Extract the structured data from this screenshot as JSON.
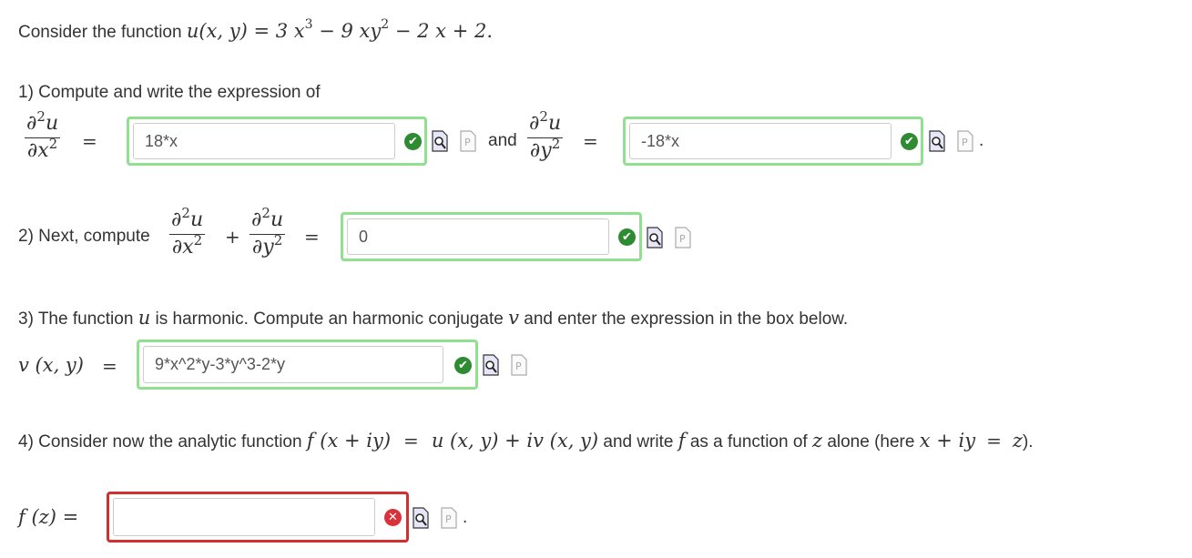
{
  "intro": {
    "text": "Consider the function ",
    "func": "u(x, y) = 3 x",
    "exp1": "3",
    "mid": " − 9 xy",
    "exp2": "2",
    "tail": " − 2 x + 2",
    "period": "."
  },
  "q1": {
    "text": "1) Compute and write the expression of",
    "frac_xx": {
      "num": "∂",
      "num_exp": "2",
      "num_var": "u",
      "den": "∂x",
      "den_exp": "2"
    },
    "frac_yy": {
      "num": "∂",
      "num_exp": "2",
      "num_var": "u",
      "den": "∂y",
      "den_exp": "2"
    },
    "eq": "=",
    "and": "and",
    "answer_xx": "18*x",
    "answer_yy": "-18*x",
    "period": "."
  },
  "q2": {
    "text": "2) Next, compute",
    "plus": "+",
    "eq": "=",
    "answer": "0"
  },
  "q3": {
    "text_a": "3) The function ",
    "var_u": "u",
    "text_b": " is harmonic. Compute an harmonic conjugate ",
    "var_v": "v",
    "text_c": " and enter the expression in the box below.",
    "lhs": "v (x, y)",
    "eq": "=",
    "answer": "9*x^2*y-3*y^3-2*y"
  },
  "q4": {
    "text_a": "4) Consider now the analytic function ",
    "expr_f": "f (x + iy)",
    "eq": "=",
    "expr_rhs": "u (x, y) + iv (x, y)",
    "text_b": " and write ",
    "var_f": "f",
    "text_c": " as a function of ",
    "var_z": "z",
    "text_d": " alone (here ",
    "expr_xiy": "x + iy",
    "eq2": "=",
    "var_z2": "z",
    "text_e": ").",
    "lhs": "f (z) =",
    "answer": "",
    "period": "."
  },
  "status": {
    "correct": "✔",
    "incorrect": "✕"
  },
  "colors": {
    "correct_border": "#90e090",
    "incorrect_border": "#d22f2f",
    "correct_badge": "#2e8b32",
    "incorrect_badge": "#d9323a"
  },
  "icons": {
    "preview": "magnifier-preview-icon",
    "answer_key": "page-p-icon"
  }
}
